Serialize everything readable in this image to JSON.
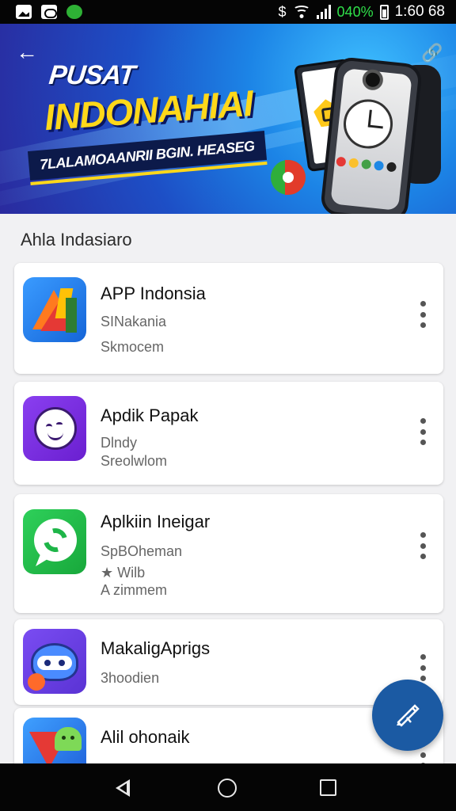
{
  "status_bar": {
    "battery_percent": "040%",
    "time": "1:60 68",
    "extra_symbol": "$"
  },
  "hero": {
    "title_line1": "PUSAT",
    "title_line2": "INDONAHIAI",
    "subtitle": "7LALAMOAANRII BGIN. HEASEG"
  },
  "section_title": "Ahla Indasiaro",
  "apps": [
    {
      "name": "APP Indonsia",
      "meta1": "SINakania",
      "meta2": "Skmocem",
      "icon": "colorful-a-icon"
    },
    {
      "name": "Apdik Papak",
      "meta1": "Dlndy",
      "meta2": "Sreolwlom",
      "icon": "smiley-face-icon"
    },
    {
      "name": "Aplkiin Ineigar",
      "meta1": "SpBOheman",
      "meta2": "★ Wilb",
      "meta3": "A zimmem",
      "icon": "green-chat-icon"
    },
    {
      "name": "MakaligAprigs",
      "meta1": "3hoodien",
      "icon": "robot-icon"
    },
    {
      "name": "Alil ohonaik",
      "meta1": "",
      "icon": "android-triangle-icon"
    }
  ],
  "colors": {
    "fab": "#1b5aa3",
    "accent_yellow": "#ffd81a",
    "banner_blue": "#1d4fc6"
  }
}
